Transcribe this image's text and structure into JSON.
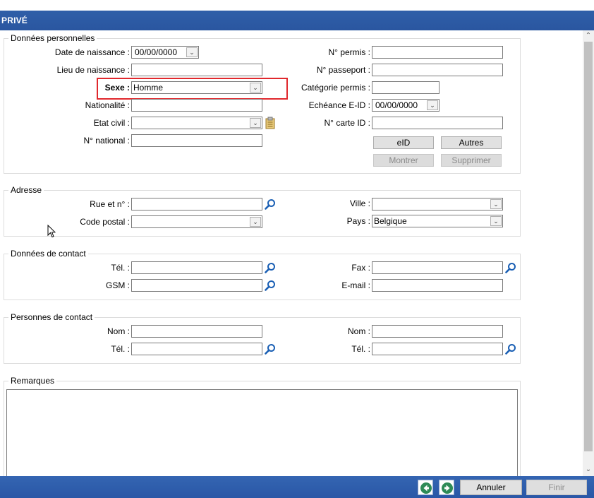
{
  "header": {
    "title": "PRIVÉ"
  },
  "personal": {
    "title": "Données personnelles",
    "birthdate_label": "Date de naissance :",
    "birthdate_value": "00/00/0000",
    "birthplace_label": "Lieu de naissance :",
    "birthplace_value": "",
    "sex_label": "Sexe :",
    "sex_value": "Homme",
    "nationality_label": "Nationalité :",
    "nationality_value": "",
    "civil_state_label": "Etat civil :",
    "civil_state_value": "",
    "national_no_label": "N° national :",
    "national_no_value": "",
    "permit_label": "N° permis :",
    "permit_value": "",
    "passport_label": "N° passeport :",
    "passport_value": "",
    "permit_category_label": "Catégorie permis :",
    "permit_category_value": "",
    "eid_expiry_label": "Echéance E-ID :",
    "eid_expiry_value": "00/00/0000",
    "id_card_label": "N° carte ID :",
    "id_card_value": "",
    "eid_button": "eID",
    "others_button": "Autres",
    "show_button": "Montrer",
    "delete_button": "Supprimer"
  },
  "address": {
    "title": "Adresse",
    "street_label": "Rue et n° :",
    "street_value": "",
    "postal_label": "Code postal :",
    "postal_value": "",
    "city_label": "Ville :",
    "city_value": "",
    "country_label": "Pays :",
    "country_value": "Belgique"
  },
  "contact": {
    "title": "Données de contact",
    "tel_label": "Tél. :",
    "tel_value": "",
    "gsm_label": "GSM :",
    "gsm_value": "",
    "fax_label": "Fax :",
    "fax_value": "",
    "email_label": "E-mail :",
    "email_value": ""
  },
  "contact_persons": {
    "title": "Personnes de contact",
    "name1_label": "Nom :",
    "name1_value": "",
    "tel1_label": "Tél. :",
    "tel1_value": "",
    "name2_label": "Nom :",
    "name2_value": "",
    "tel2_label": "Tél. :",
    "tel2_value": ""
  },
  "remarks": {
    "title": "Remarques",
    "value": ""
  },
  "footer": {
    "cancel_label": "Annuler",
    "finish_label": "Finir"
  },
  "colors": {
    "title_bar": "#2f5fa8",
    "highlight": "#e0282d",
    "search_icon": "#1a5fb4",
    "nav_icon": "#2e8b57"
  },
  "icons": [
    "magnifier-icon",
    "clipboard-icon",
    "chevron-down-icon",
    "arrow-left-icon",
    "arrow-right-icon",
    "mouse-cursor-icon"
  ]
}
